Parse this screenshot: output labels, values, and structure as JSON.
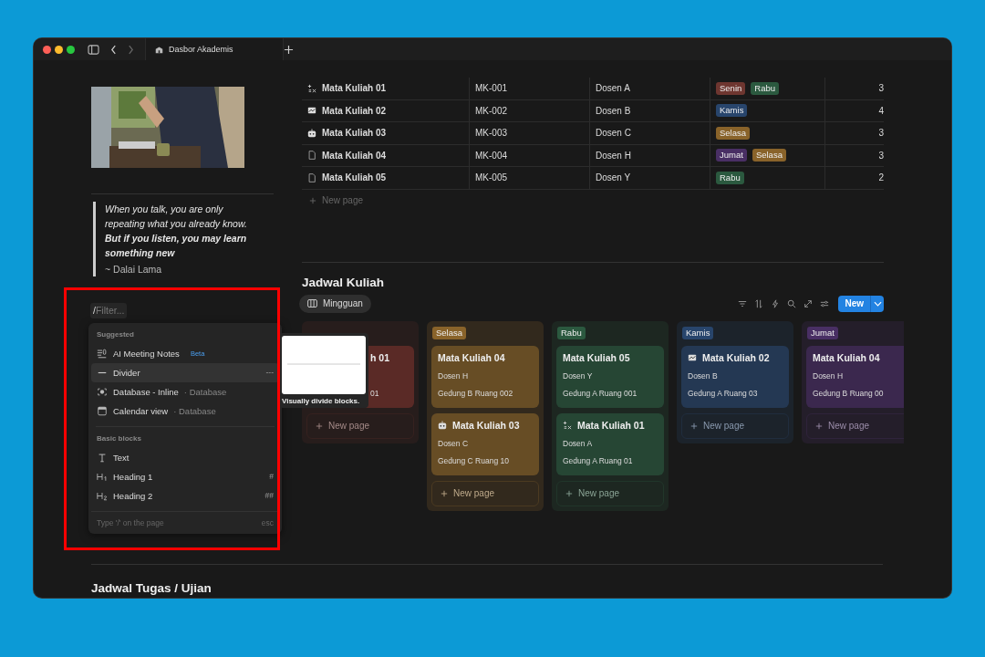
{
  "browser": {
    "tab_title": "Dasbor Akademis"
  },
  "sidebar": {
    "quote": {
      "text": "When you talk, you are only repeating what you already know. **But if you listen, you may learn something new**",
      "author": "~ Dalai Lama"
    }
  },
  "table": {
    "rows": [
      {
        "kind": "sparkle",
        "name": "Mata Kuliah 01",
        "code": "MK-001",
        "lecturer": "Dosen A",
        "days": [
          {
            "label": "Senin",
            "color": "#6e3630"
          },
          {
            "label": "Rabu",
            "color": "#2b593f"
          }
        ],
        "column_5": "3"
      },
      {
        "kind": "chart",
        "name": "Mata Kuliah 02",
        "code": "MK-002",
        "lecturer": "Dosen B",
        "days": [
          {
            "label": "Kamis",
            "color": "#28456c"
          }
        ],
        "column_5": "4"
      },
      {
        "kind": "robot",
        "name": "Mata Kuliah 03",
        "code": "MK-003",
        "lecturer": "Dosen C",
        "days": [
          {
            "label": "Selasa",
            "color": "#89632a"
          }
        ],
        "column_5": "3"
      },
      {
        "kind": "page",
        "name": "Mata Kuliah 04",
        "code": "MK-004",
        "lecturer": "Dosen H",
        "days": [
          {
            "label": "Jumat",
            "color": "#492f64"
          },
          {
            "label": "Selasa",
            "color": "#89632a"
          }
        ],
        "column_5": "3"
      },
      {
        "kind": "page",
        "name": "Mata Kuliah 05",
        "code": "MK-005",
        "lecturer": "Dosen Y",
        "days": [
          {
            "label": "Rabu",
            "color": "#2b593f"
          }
        ],
        "column_5": "2"
      }
    ],
    "new_page": "New page"
  },
  "schedule": {
    "title": "Jadwal Kuliah",
    "views": [
      {
        "label": "Mingguan",
        "selected": true
      }
    ],
    "new_button": "New",
    "columns": [
      {
        "color": "#5a2a26",
        "cards": [
          {
            "title": "h 01",
            "room": "01"
          }
        ],
        "new_page": "New page"
      },
      {
        "label": "Selasa",
        "color": "#89632a",
        "cards": [
          {
            "title": "Mata Kuliah 04",
            "lecturer": "Dosen H",
            "room": "Gedung B Ruang 002"
          },
          {
            "kind": "robot",
            "title": "Mata Kuliah 03",
            "lecturer": "Dosen C",
            "room": "Gedung C Ruang 10"
          }
        ],
        "new_page": "New page"
      },
      {
        "label": "Rabu",
        "color": "#2b593f",
        "cards": [
          {
            "title": "Mata Kuliah 05",
            "lecturer": "Dosen Y",
            "room": "Gedung A Ruang 001"
          },
          {
            "kind": "sparkle",
            "title": "Mata Kuliah 01",
            "lecturer": "Dosen A",
            "room": "Gedung A Ruang 01"
          }
        ],
        "new_page": "New page"
      },
      {
        "label": "Kamis",
        "color": "#28456c",
        "cards": [
          {
            "kind": "chart",
            "title": "Mata Kuliah 02",
            "lecturer": "Dosen B",
            "room": "Gedung A Ruang 03"
          }
        ],
        "new_page": "New page"
      },
      {
        "label": "Jumat",
        "color": "#492f64",
        "cards": [
          {
            "title": "Mata Kuliah 04",
            "lecturer": "Dosen H",
            "room": "Gedung B Ruang 00"
          }
        ],
        "new_page": "New page"
      }
    ]
  },
  "slash_menu": {
    "filter": {
      "value": "/",
      "placeholder": "Filter..."
    },
    "sections": [
      {
        "title": "Suggested",
        "items": [
          {
            "kind": "notes",
            "label": "AI Meeting Notes",
            "badge": "Beta",
            "selected": false
          },
          {
            "kind": "divider",
            "label": "Divider",
            "shortcut": "---",
            "selected": true
          },
          {
            "kind": "database",
            "label": "Database - Inline",
            "hint": "· Database",
            "selected": false
          },
          {
            "kind": "calendar",
            "label": "Calendar view",
            "hint": "· Database",
            "selected": false
          }
        ]
      },
      {
        "title": "Basic blocks",
        "items": [
          {
            "kind": "text",
            "label": "Text",
            "selected": false
          },
          {
            "kind": "h1",
            "label": "Heading 1",
            "shortcut": "#",
            "selected": false
          },
          {
            "kind": "h2",
            "label": "Heading 2",
            "shortcut": "##",
            "selected": false
          }
        ]
      }
    ],
    "footer": "Type '/' on the page",
    "footer_key": "esc",
    "preview": {
      "caption": "Visually divide blocks."
    }
  },
  "next_section": {
    "title": "Jadwal Tugas / Ujian"
  }
}
